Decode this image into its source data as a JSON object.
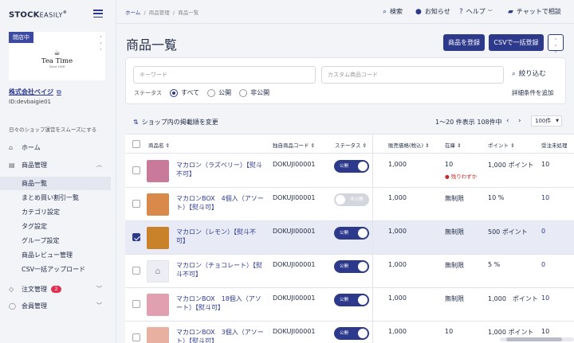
{
  "app": {
    "brand_bold": "STOCK",
    "brand_thin": "EASILY",
    "brand_mark": "®"
  },
  "shop": {
    "status_badge": "閲店中",
    "logo_text": "Tea Time",
    "logo_since": "Since 1918",
    "company_name": "株式会社ベイジ",
    "company_id": "ID:devbaigie01",
    "tagline": "日々のショップ運営をスムーズにする"
  },
  "nav": {
    "home": "ホーム",
    "products": "商品管理",
    "product_sub": [
      "商品一覧",
      "まとめ買い割引一覧",
      "カテゴリ設定",
      "タグ設定",
      "グループ設定",
      "商品レビュー管理",
      "CSV一括アップロード"
    ],
    "orders": "注文管理",
    "orders_count": "2",
    "members": "会員管理"
  },
  "topbar": {
    "crumb_home": "ホーム",
    "crumb_products": "商品管理",
    "crumb_current": "商品一覧",
    "search": "検索",
    "notify": "お知らせ",
    "help": "ヘルプ",
    "chat": "チャットで相談"
  },
  "page": {
    "title": "商品一覧",
    "register_btn": "商品を登録",
    "csv_btn": "CSVで一括登録"
  },
  "search": {
    "keyword_placeholder": "キーワード",
    "custom_code_placeholder": "カスタム商品コード",
    "refine": "絞り込む",
    "status_label": "ステータス",
    "status_all": "すべて",
    "status_public": "公開",
    "status_private": "非公開",
    "detail_link": "詳細条件を追加"
  },
  "list": {
    "sort_link": "ショップ内の掲載順を変更",
    "range": "1〜20 件表示  108件中",
    "per_page": "100件"
  },
  "table": {
    "headers": {
      "name": "商品名",
      "code": "独自商品コード",
      "status": "ステータス",
      "price": "販売価格(税込)",
      "stock": "在庫",
      "point": "ポイント",
      "orders": "受注未処理"
    },
    "rows": [
      {
        "name": "マカロン（ラズベリー）【熨斗不可】",
        "code": "DOKUJI00001",
        "status": "公開",
        "on": true,
        "price": "1,000",
        "stock": "10",
        "stock_warn": "残りわずか",
        "point": "1,000 ポイント",
        "orders": "10",
        "selected": false,
        "thumb": "#c97a9a"
      },
      {
        "name": "マカロンBOX　4個入（アソート）【熨斗可】",
        "code": "DOKUJI00001",
        "status": "非公開",
        "on": false,
        "price": "1,000",
        "stock": "無制限",
        "stock_warn": "",
        "point": "10 %",
        "orders": "10",
        "selected": false,
        "thumb": "#d98a4a"
      },
      {
        "name": "マカロン（レモン）【熨斗不可】",
        "code": "DOKUJI00001",
        "status": "公開",
        "on": true,
        "price": "1,000",
        "stock": "無制限",
        "stock_warn": "",
        "point": "500 ポイント",
        "orders": "0",
        "selected": true,
        "thumb": "#c9822a"
      },
      {
        "name": "マカロン（チョコレート）【熨斗不可】",
        "code": "DOKUJI00001",
        "status": "公開",
        "on": true,
        "price": "1,000",
        "stock": "無制限",
        "stock_warn": "",
        "point": "5 %",
        "orders": "0",
        "selected": false,
        "thumb": "#eceef3"
      },
      {
        "name": "マカロンBOX　18個入（アソート）【熨斗可】",
        "code": "DOKUJI00001",
        "status": "公開",
        "on": true,
        "price": "1,000",
        "stock": "無制限",
        "stock_warn": "",
        "point": "1,000　ポイント",
        "orders": "10",
        "selected": false,
        "thumb": "#e0a0b0"
      },
      {
        "name": "マカロンBOX　3個入（アソート）【熨斗可】",
        "code": "DOKUJI00001",
        "status": "公開",
        "on": true,
        "price": "1,000",
        "stock": "10",
        "stock_warn": "",
        "point": "1,000 ポイント",
        "orders": "10",
        "selected": false,
        "thumb": "#e8b0a0"
      }
    ]
  }
}
